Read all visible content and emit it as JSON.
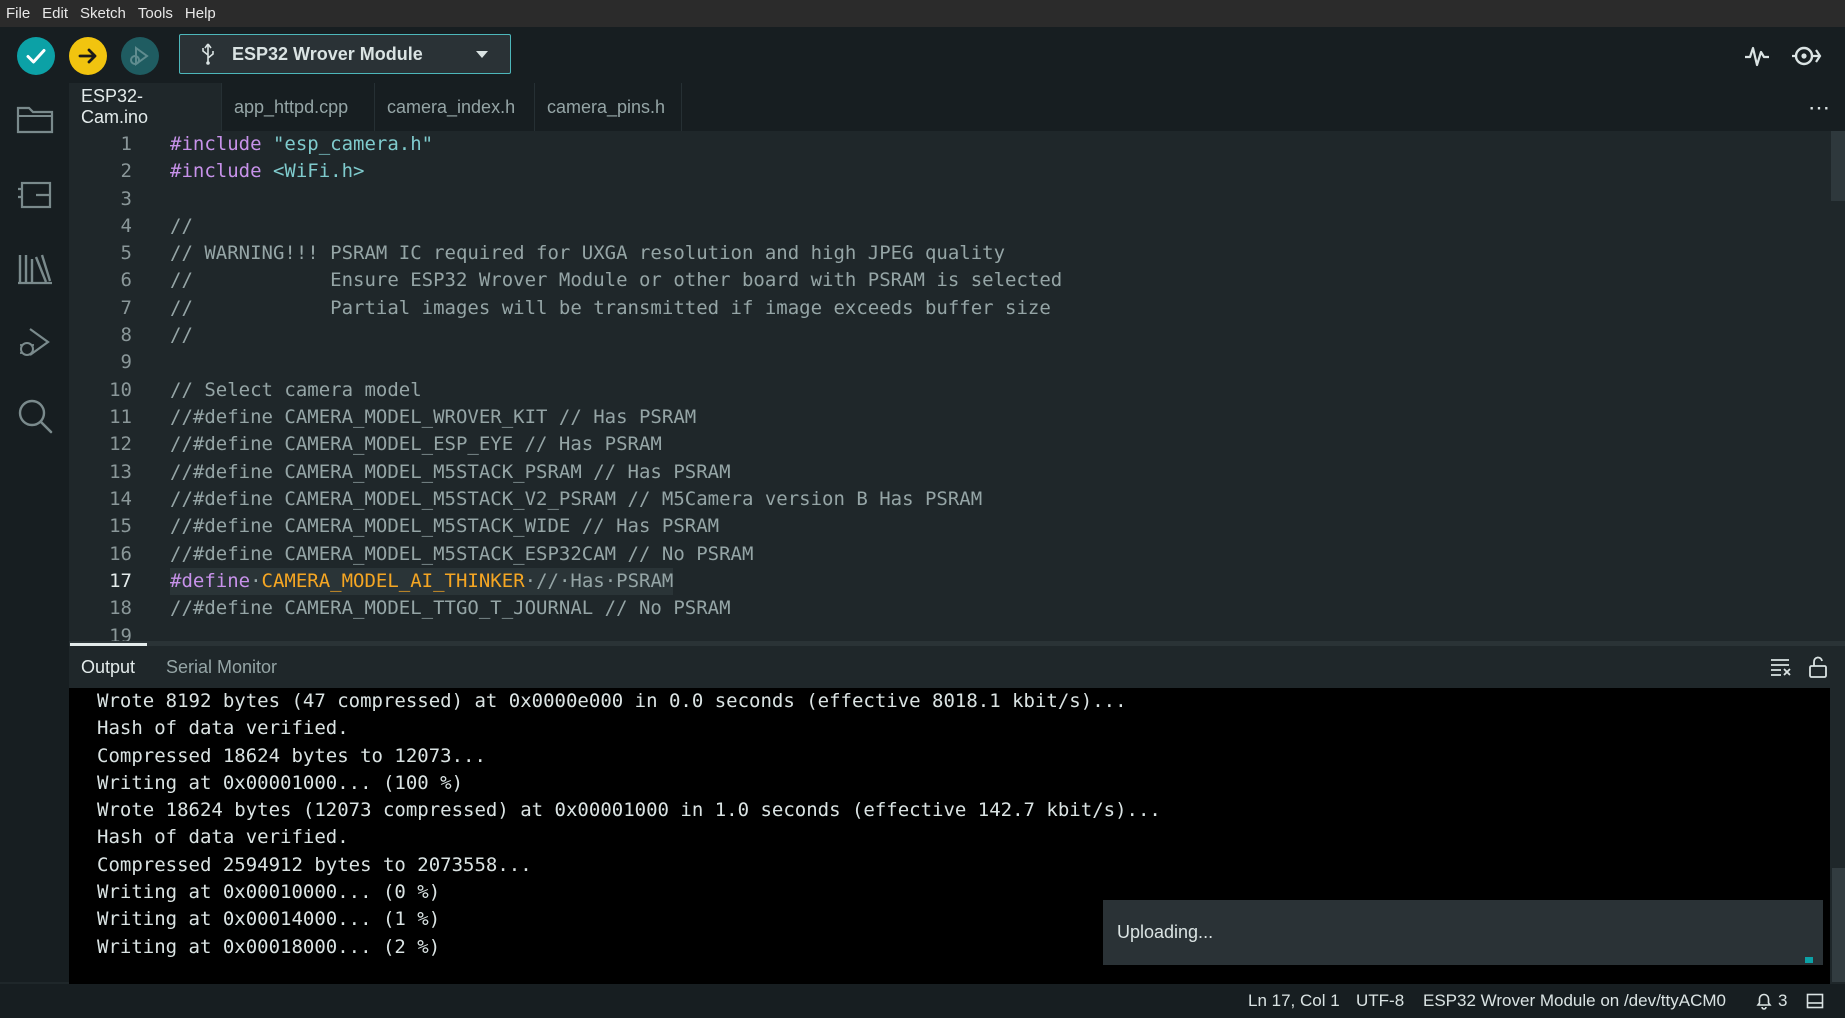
{
  "menu": [
    "File",
    "Edit",
    "Sketch",
    "Tools",
    "Help"
  ],
  "toolbar": {
    "board": "ESP32 Wrover Module",
    "colors": {
      "verify": "#0ca1a6",
      "upload": "#f1c40f",
      "debug": "#1f5c61"
    }
  },
  "sidebar": [
    "folder-icon",
    "board-manager-icon",
    "library-icon",
    "debug-icon",
    "search-icon"
  ],
  "tabs": [
    "ESP32-Cam.ino",
    "app_httpd.cpp",
    "camera_index.h",
    "camera_pins.h"
  ],
  "tabs_more": "⋯",
  "editor": {
    "current_line": "17",
    "lines": [
      {
        "n": "1",
        "pre": "#include",
        "post": " ",
        "str": "\"esp_camera.h\""
      },
      {
        "n": "2",
        "pre": "#include",
        "post": " ",
        "str": "<WiFi.h>"
      },
      {
        "n": "3",
        "text": ""
      },
      {
        "n": "4",
        "text": "//"
      },
      {
        "n": "5",
        "text": "// WARNING!!! PSRAM IC required for UXGA resolution and high JPEG quality"
      },
      {
        "n": "6",
        "text": "//            Ensure ESP32 Wrover Module or other board with PSRAM is selected"
      },
      {
        "n": "7",
        "text": "//            Partial images will be transmitted if image exceeds buffer size"
      },
      {
        "n": "8",
        "text": "//"
      },
      {
        "n": "9",
        "text": ""
      },
      {
        "n": "10",
        "text": "// Select camera model"
      },
      {
        "n": "11",
        "text": "//#define CAMERA_MODEL_WROVER_KIT // Has PSRAM"
      },
      {
        "n": "12",
        "text": "//#define CAMERA_MODEL_ESP_EYE // Has PSRAM"
      },
      {
        "n": "13",
        "text": "//#define CAMERA_MODEL_M5STACK_PSRAM // Has PSRAM"
      },
      {
        "n": "14",
        "text": "//#define CAMERA_MODEL_M5STACK_V2_PSRAM // M5Camera version B Has PSRAM"
      },
      {
        "n": "15",
        "text": "//#define CAMERA_MODEL_M5STACK_WIDE // Has PSRAM"
      },
      {
        "n": "16",
        "text": "//#define CAMERA_MODEL_M5STACK_ESP32CAM // No PSRAM"
      },
      {
        "n": "17",
        "pre": "#define",
        "dot1": "·",
        "macro": "CAMERA_MODEL_AI_THINKER",
        "rest": "·//·Has·PSRAM"
      },
      {
        "n": "18",
        "text": "//#define CAMERA_MODEL_TTGO_T_JOURNAL // No PSRAM"
      },
      {
        "n": "19",
        "text": ""
      }
    ]
  },
  "panel_tabs": [
    "Output",
    "Serial Monitor"
  ],
  "output": [
    "Wrote 8192 bytes (47 compressed) at 0x0000e000 in 0.0 seconds (effective 8018.1 kbit/s)...",
    "Hash of data verified.",
    "Compressed 18624 bytes to 12073...",
    "Writing at 0x00001000... (100 %)",
    "Wrote 18624 bytes (12073 compressed) at 0x00001000 in 1.0 seconds (effective 142.7 kbit/s)...",
    "Hash of data verified.",
    "Compressed 2594912 bytes to 2073558...",
    "Writing at 0x00010000... (0 %)",
    "Writing at 0x00014000... (1 %)",
    "Writing at 0x00018000... (2 %)"
  ],
  "toast": "Uploading...",
  "status": {
    "position": "Ln 17, Col 1",
    "encoding": "UTF-8",
    "board_port": "ESP32 Wrover Module on /dev/ttyACM0",
    "notifications": "3"
  }
}
